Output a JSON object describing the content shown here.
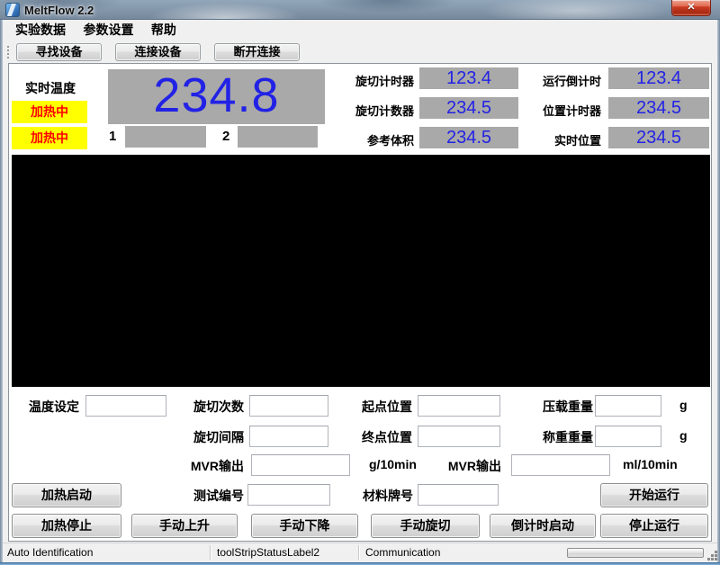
{
  "window": {
    "title": "MeltFlow 2.2"
  },
  "icons": {
    "close": "✕"
  },
  "menu": {
    "items": [
      "实验数据",
      "参数设置",
      "帮助"
    ]
  },
  "toolbar": {
    "buttons": [
      "寻找设备",
      "连接设备",
      "断开连接"
    ]
  },
  "monitor": {
    "temp_label": "实时温度",
    "heat_status_1": "加热中",
    "heat_status_2": "加热中",
    "temperature": "234.8",
    "channel_1": "1",
    "channel_2": "2",
    "counters": [
      {
        "label": "旋切计时器",
        "value": "123.4"
      },
      {
        "label": "运行倒计时",
        "value": "123.4"
      },
      {
        "label": "旋切计数器",
        "value": "234.5"
      },
      {
        "label": "位置计时器",
        "value": "234.5"
      },
      {
        "label": "参考体积",
        "value": "234.5"
      },
      {
        "label": "实时位置",
        "value": "234.5"
      }
    ]
  },
  "form": {
    "temp_set_label": "温度设定",
    "cut_count_label": "旋切次数",
    "cut_interval_label": "旋切间隔",
    "mvr_g_label": "MVR输出",
    "mvr_g_unit": "g/10min",
    "mvr_ml_label": "MVR输出",
    "mvr_ml_unit": "ml/10min",
    "start_pos_label": "起点位置",
    "end_pos_label": "终点位置",
    "ballast_label": "压载重量",
    "ballast_unit": "g",
    "weigh_label": "称重重量",
    "weigh_unit": "g",
    "test_id_label": "测试编号",
    "material_label": "材料牌号"
  },
  "buttons": {
    "heat_start": "加热启动",
    "heat_stop": "加热停止",
    "manual_up": "手动上升",
    "manual_down": "手动下降",
    "manual_cut": "手动旋切",
    "countdown_start": "倒计时启动",
    "run_start": "开始运行",
    "run_stop": "停止运行"
  },
  "statusbar": {
    "auto_id": "Auto Identification",
    "status2": "toolStripStatusLabel2",
    "communication": "Communication"
  },
  "colors": {
    "value_blue": "#2222e6",
    "display_gray": "#a9a9a9",
    "heat_bg": "#ffff00",
    "heat_text": "#ff0000"
  }
}
